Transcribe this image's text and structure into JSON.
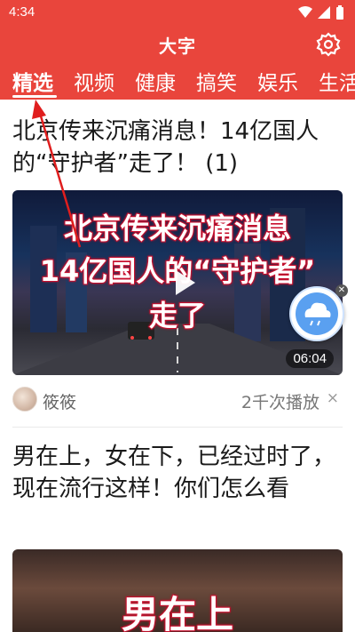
{
  "status_bar": {
    "time": "4:34"
  },
  "app": {
    "logo_text": "大字",
    "brand_color": "#e9453c"
  },
  "tabs": [
    {
      "label": "精选",
      "active": true
    },
    {
      "label": "视频"
    },
    {
      "label": "健康"
    },
    {
      "label": "搞笑"
    },
    {
      "label": "娱乐"
    },
    {
      "label": "生活"
    }
  ],
  "feed": [
    {
      "title": "北京传来沉痛消息！14亿国人的“守护者”走了！ (1)",
      "overlay_lines": [
        "北京传来沉痛消息",
        "14亿国人的“守护者”",
        "走了"
      ],
      "duration": "06:04",
      "author": "筱筱",
      "plays": "2千次播放",
      "close": "×"
    },
    {
      "title": "男在上，女在下，已经过时了，现在流行这样！你们怎么看",
      "overlay_lines": [
        "男在上"
      ]
    }
  ],
  "icons": [
    "gear-icon",
    "play-icon",
    "weather-widget-icon",
    "close-icon"
  ]
}
